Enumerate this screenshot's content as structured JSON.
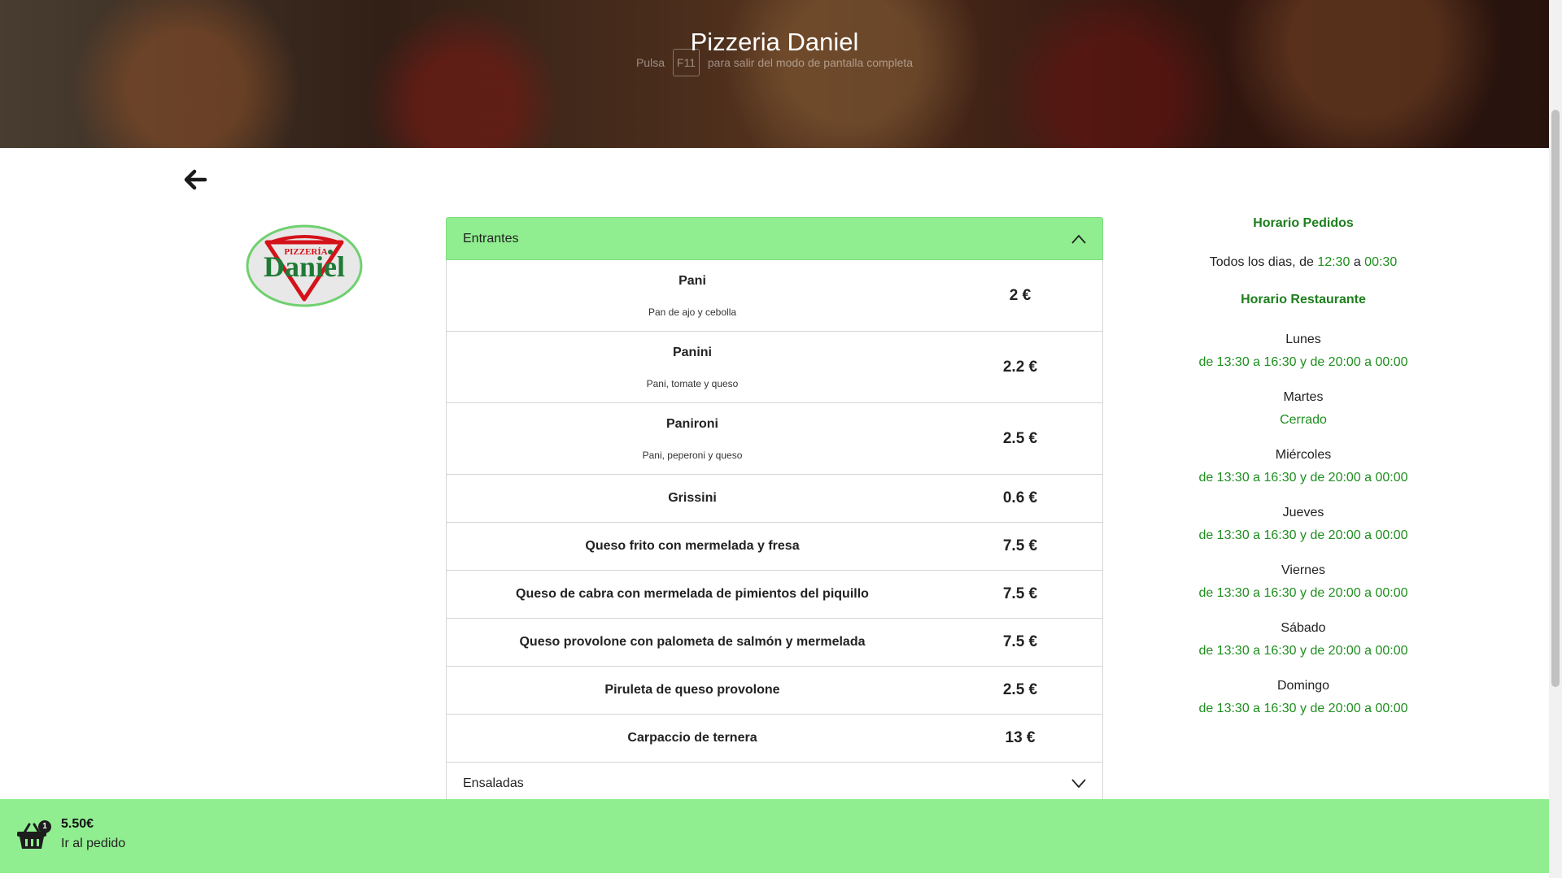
{
  "header": {
    "title": "Pizzeria Daniel",
    "fullscreen_hint": {
      "before": "Pulsa",
      "key": "F11",
      "after": "para salir del modo de pantalla completa"
    }
  },
  "logo": {
    "top_text": "PIZZERÍA",
    "main_text": "Daniel",
    "colors": {
      "ring": "#3fb34f",
      "red": "#d4121a",
      "green": "#1f7a36"
    }
  },
  "menu": {
    "sections": [
      {
        "label": "Entrantes",
        "expanded": true
      },
      {
        "label": "Ensaladas",
        "expanded": false
      }
    ],
    "items": [
      {
        "name": "Pani",
        "description": "Pan de ajo y cebolla",
        "price": "2 €"
      },
      {
        "name": "Panini",
        "description": "Pani, tomate y queso",
        "price": "2.2 €"
      },
      {
        "name": "Panironi",
        "description": "Pani, peperoni y queso",
        "price": "2.5 €"
      },
      {
        "name": "Grissini",
        "price": "0.6 €"
      },
      {
        "name": "Queso frito con mermelada y fresa",
        "price": "7.5 €"
      },
      {
        "name": "Queso de cabra con mermelada de pimientos del piquillo",
        "price": "7.5 €"
      },
      {
        "name": "Queso provolone con palometa de salmón y mermelada",
        "price": "7.5 €"
      },
      {
        "name": "Piruleta de queso provolone",
        "price": "2.5 €"
      },
      {
        "name": "Carpaccio de ternera",
        "price": "13 €"
      }
    ]
  },
  "schedule": {
    "orders_title": "Horario Pedidos",
    "orders_text": {
      "prefix": "Todos los dias, de",
      "from": "12:30",
      "middle": "a",
      "to": "00:30"
    },
    "restaurant_title": "Horario Restaurante",
    "days": [
      {
        "day": "Lunes",
        "hours": "de 13:30 a 16:30 y de 20:00 a 00:00"
      },
      {
        "day": "Martes",
        "hours": "Cerrado"
      },
      {
        "day": "Miércoles",
        "hours": "de 13:30 a 16:30 y de 20:00 a 00:00"
      },
      {
        "day": "Jueves",
        "hours": "de 13:30 a 16:30 y de 20:00 a 00:00"
      },
      {
        "day": "Viernes",
        "hours": "de 13:30 a 16:30 y de 20:00 a 00:00"
      },
      {
        "day": "Sábado",
        "hours": "de 13:30 a 16:30 y de 20:00 a 00:00"
      },
      {
        "day": "Domingo",
        "hours": "de 13:30 a 16:30 y de 20:00 a 00:00"
      }
    ]
  },
  "cart": {
    "count": "1",
    "total": "5.50€",
    "action_label": "Ir al pedido"
  },
  "theme": {
    "accent": "#90ee90",
    "schedule_green": "#1e8e1e"
  }
}
